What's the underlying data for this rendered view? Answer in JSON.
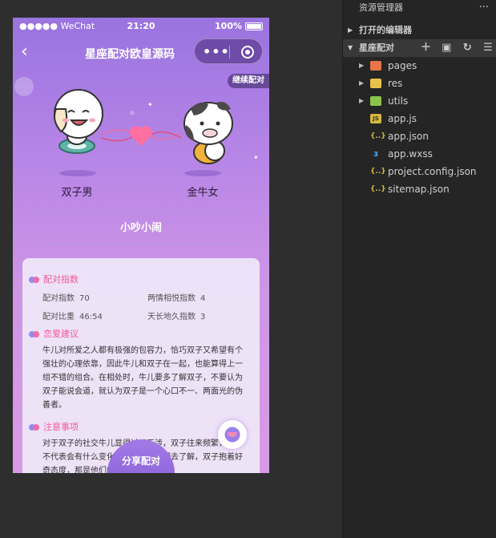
{
  "statusbar": {
    "carrier": "●●●●● WeChat",
    "time": "21:20",
    "battery": "100%"
  },
  "navbar": {
    "back_icon": "‹",
    "title": "星座配对欧皇源码",
    "more_icon": "•••"
  },
  "continue_label": "继续配对",
  "characters": {
    "left_name": "双子男",
    "right_name": "金牛女"
  },
  "tag": "小吵小闹",
  "card": {
    "index_title": "配对指数",
    "stats": [
      {
        "label": "配对指数",
        "value": "70"
      },
      {
        "label": "两情相悦指数",
        "value": "4"
      },
      {
        "label": "配对比重",
        "value": "46:54"
      },
      {
        "label": "天长地久指数",
        "value": "3"
      }
    ],
    "advice_title": "恋爱建议",
    "advice_text": "牛儿对所爱之人都有极强的包容力，恰巧双子又希望有个强壮的心理依靠，因此牛儿和双子在一起，也能算得上一组不错的组合。在相处时，牛儿要多了解双子，不要认为双子能说会道，就认为双子是一个心口不一、两面光的伪善者。",
    "notes_title": "注意事项",
    "notes_text": "对于双子的社交牛儿显得过于干涉，双子往来频繁，但并不代表会有什么变化。牛儿应该试图去了解，双子抱着好奇态度，那是他们的习"
  },
  "share_label": "分享配对",
  "explorer": {
    "header": "资源管理器",
    "open_editors": "打开的编辑器",
    "project": "星座配对",
    "items": [
      {
        "label": "pages",
        "type": "folder",
        "icon": "folder-icon"
      },
      {
        "label": "res",
        "type": "folder",
        "icon": "folder-icon"
      },
      {
        "label": "utils",
        "type": "folder",
        "icon": "folder-icon"
      },
      {
        "label": "app.js",
        "type": "file",
        "icon": "js-file-icon"
      },
      {
        "label": "app.json",
        "type": "file",
        "icon": "json-file-icon"
      },
      {
        "label": "app.wxss",
        "type": "file",
        "icon": "css-file-icon"
      },
      {
        "label": "project.config.json",
        "type": "file",
        "icon": "json-file-icon"
      },
      {
        "label": "sitemap.json",
        "type": "file",
        "icon": "json-file-icon"
      }
    ]
  },
  "colors": {
    "accent_pink": "#f05a9b",
    "purple_top": "#9a73e0",
    "explorer_bg": "#252526"
  }
}
